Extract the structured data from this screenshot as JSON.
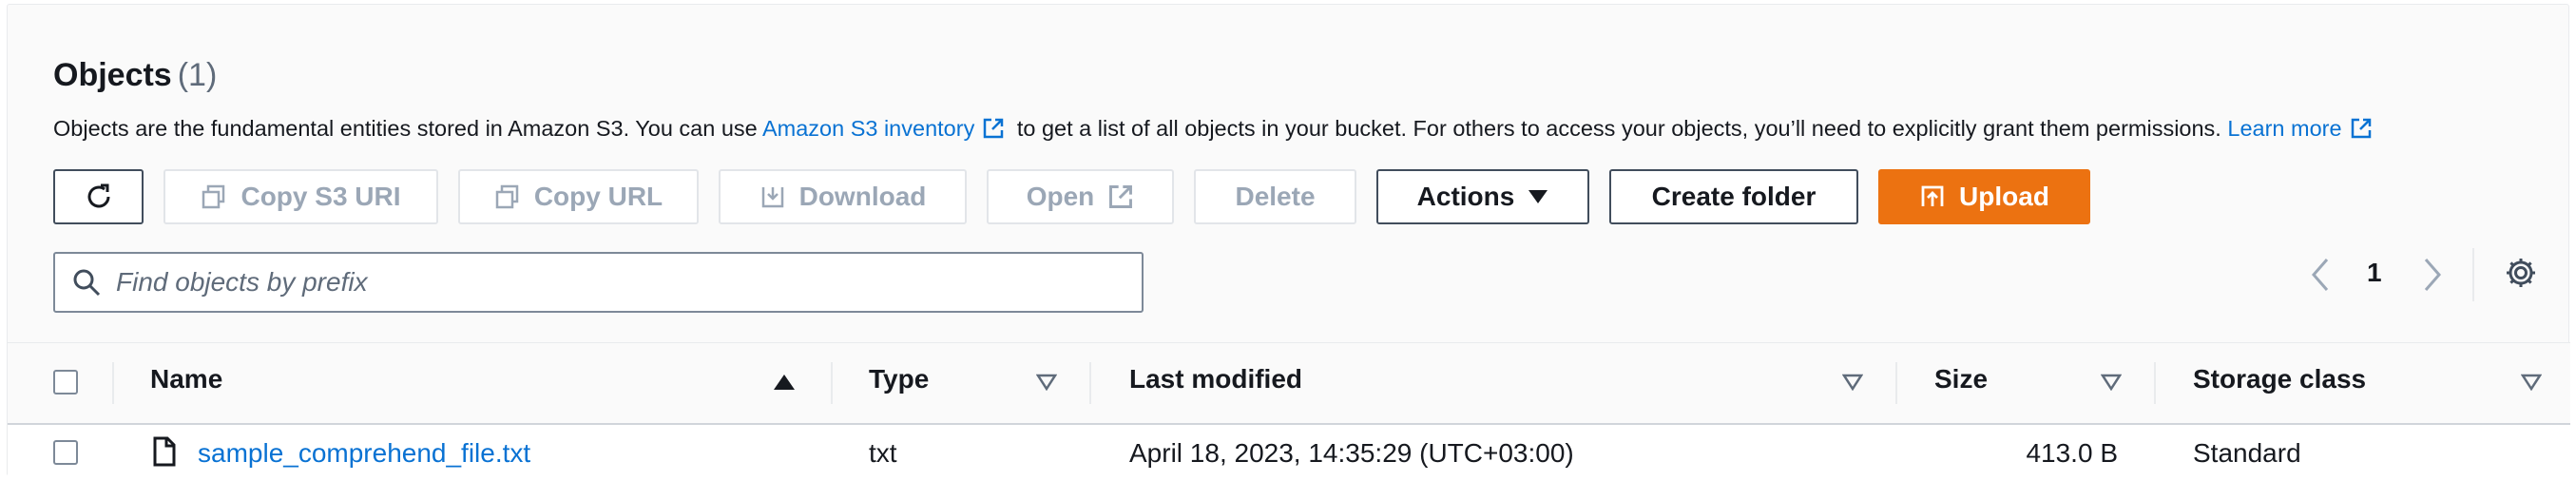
{
  "header": {
    "title": "Objects",
    "count": "(1)"
  },
  "description": {
    "text_before": "Objects are the fundamental entities stored in Amazon S3. You can use ",
    "inventory_link": "Amazon S3 inventory",
    "text_middle": " to get a list of all objects in your bucket. For others to access your objects, you’ll need to explicitly grant them permissions. ",
    "learn_more_link": "Learn more"
  },
  "toolbar": {
    "refresh_icon": "refresh-icon",
    "copy_s3_uri": "Copy S3 URI",
    "copy_url": "Copy URL",
    "download": "Download",
    "open": "Open",
    "delete": "Delete",
    "actions": "Actions",
    "create_folder": "Create folder",
    "upload": "Upload"
  },
  "search": {
    "placeholder": "Find objects by prefix"
  },
  "pagination": {
    "current_page": "1"
  },
  "table": {
    "columns": [
      "Name",
      "Type",
      "Last modified",
      "Size",
      "Storage class"
    ],
    "rows": [
      {
        "name": "sample_comprehend_file.txt",
        "type": "txt",
        "last_modified": "April 18, 2023, 14:35:29 (UTC+03:00)",
        "size": "413.0 B",
        "storage_class": "Standard"
      }
    ]
  },
  "colors": {
    "accent": "#0972d3",
    "primary": "#ec7211",
    "border": "#7d8998"
  }
}
